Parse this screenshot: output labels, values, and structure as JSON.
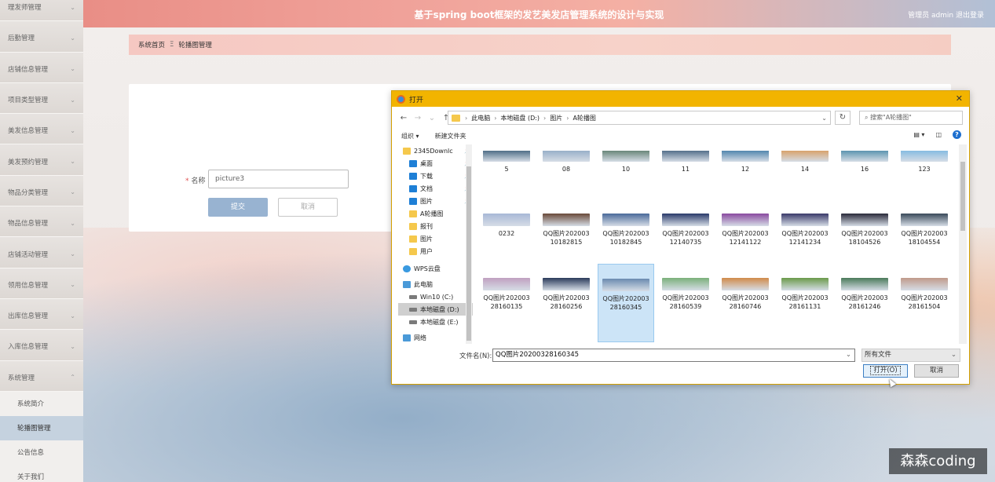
{
  "header": {
    "title": "基于spring boot框架的发艺美发店管理系统的设计与实现",
    "user": "管理员 admin 退出登录"
  },
  "sidebar": {
    "items": [
      "理发师管理",
      "后勤管理",
      "店铺信息管理",
      "项目类型管理",
      "美发信息管理",
      "美发预约管理",
      "物品分类管理",
      "物品信息管理",
      "店铺活动管理",
      "领用信息管理",
      "出库信息管理",
      "入库信息管理",
      "系统管理"
    ],
    "sub": [
      "系统简介",
      "轮播图管理",
      "公告信息",
      "关于我们"
    ]
  },
  "breadcrumb": {
    "home": "系统首页",
    "sep": "Ξ",
    "current": "轮播图管理"
  },
  "form": {
    "name_label": "名称",
    "name_value": "picture3",
    "submit": "提交",
    "cancel": "取消"
  },
  "dialog": {
    "title": "打开",
    "address": [
      "此电脑",
      "本地磁盘 (D:)",
      "图片",
      "A轮播图"
    ],
    "search_placeholder": "搜索\"A轮播图\"",
    "toolbar": {
      "organize": "组织 ▾",
      "new_folder": "新建文件夹"
    },
    "nav": [
      {
        "label": "2345Downlc",
        "icon": "fold",
        "pin": true
      },
      {
        "label": "桌面",
        "icon": "blue",
        "pin": true
      },
      {
        "label": "下载",
        "icon": "blue",
        "pin": true
      },
      {
        "label": "文档",
        "icon": "blue",
        "pin": true
      },
      {
        "label": "图片",
        "icon": "blue",
        "pin": true
      },
      {
        "label": "A轮播图",
        "icon": "fold",
        "pin": false
      },
      {
        "label": "报刊",
        "icon": "fold",
        "pin": false
      },
      {
        "label": "图片",
        "icon": "fold",
        "pin": false
      },
      {
        "label": "用户",
        "icon": "fold",
        "pin": false
      },
      {
        "label": "",
        "icon": "",
        "pin": false
      },
      {
        "label": "WPS云盘",
        "icon": "cloud",
        "pin": false
      },
      {
        "label": "",
        "icon": "",
        "pin": false
      },
      {
        "label": "此电脑",
        "icon": "pc",
        "pin": false
      },
      {
        "label": "Win10 (C:)",
        "icon": "drive",
        "pin": false
      },
      {
        "label": "本地磁盘 (D:)",
        "icon": "drive",
        "pin": false,
        "selected": true
      },
      {
        "label": "本地磁盘 (E:)",
        "icon": "drive",
        "pin": false
      },
      {
        "label": "",
        "icon": "",
        "pin": false
      },
      {
        "label": "网络",
        "icon": "pc",
        "pin": false
      }
    ],
    "files": [
      {
        "name": "5",
        "color": "#3c5f7a"
      },
      {
        "name": "08",
        "color": "#8fa9c4"
      },
      {
        "name": "10",
        "color": "#5a7a6a"
      },
      {
        "name": "11",
        "color": "#42607e"
      },
      {
        "name": "12",
        "color": "#3f7aa6"
      },
      {
        "name": "14",
        "color": "#d89a5a"
      },
      {
        "name": "16",
        "color": "#4a8aa8"
      },
      {
        "name": "123",
        "color": "#7bb7e0"
      },
      {
        "name": "0232",
        "color": "#a8b8d6"
      },
      {
        "name": "QQ图片20200310182815",
        "color": "#6a4a3a"
      },
      {
        "name": "QQ图片20200310182845",
        "color": "#4a6a9a"
      },
      {
        "name": "QQ图片20200312140735",
        "color": "#2a3a6a"
      },
      {
        "name": "QQ图片20200312141122",
        "color": "#8a4aa0"
      },
      {
        "name": "QQ图片20200312141234",
        "color": "#3a3a6a"
      },
      {
        "name": "QQ图片20200318104526",
        "color": "#2a2a3a"
      },
      {
        "name": "QQ图片20200318104554",
        "color": "#3a4a5a"
      },
      {
        "name": "QQ图片20200328160135",
        "color": "#c0a0c0"
      },
      {
        "name": "QQ图片20200328160256",
        "color": "#2a3a5a"
      },
      {
        "name": "QQ图片20200328160345",
        "color": "#6a8ab0",
        "selected": true
      },
      {
        "name": "QQ图片20200328160539",
        "color": "#7ab07a"
      },
      {
        "name": "QQ图片20200328160746",
        "color": "#d08a4a"
      },
      {
        "name": "QQ图片20200328161131",
        "color": "#6a9a4a"
      },
      {
        "name": "QQ图片20200328161246",
        "color": "#4a7a5a"
      },
      {
        "name": "QQ图片20200328161504",
        "color": "#c09a8a"
      }
    ],
    "filename_label": "文件名(N):",
    "filename_value": "QQ图片20200328160345",
    "filetype": "所有文件",
    "open": "打开(O)",
    "cancel": "取消"
  },
  "watermark": "森森coding"
}
